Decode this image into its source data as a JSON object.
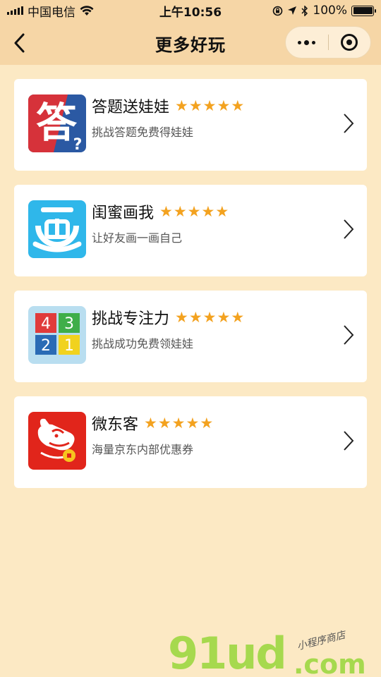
{
  "status_bar": {
    "carrier": "中国电信",
    "time": "上午10:56",
    "battery": "100%"
  },
  "nav": {
    "title": "更多好玩"
  },
  "items": [
    {
      "title": "答题送娃娃",
      "rating": 5,
      "desc": "挑战答题免费得娃娃",
      "icon": "answer-quiz-icon"
    },
    {
      "title": "闺蜜画我",
      "rating": 5,
      "desc": "让好友画一画自己",
      "icon": "draw-me-icon"
    },
    {
      "title": "挑战专注力",
      "rating": 5,
      "desc": "挑战成功免费领娃娃",
      "icon": "number-grid-icon"
    },
    {
      "title": "微东客",
      "rating": 5,
      "desc": "海量京东内部优惠券",
      "icon": "jd-dog-icon"
    }
  ],
  "icon_texts": {
    "quiz_char": "答",
    "grid_numbers": [
      "4",
      "3",
      "2",
      "1"
    ]
  },
  "watermark": {
    "main": "91ud",
    "domain": ".com",
    "sub": "小程序商店"
  },
  "colors": {
    "background": "#fce9c4",
    "nav_background": "#f6d6a6",
    "star": "#f3a21f",
    "card": "#ffffff"
  }
}
